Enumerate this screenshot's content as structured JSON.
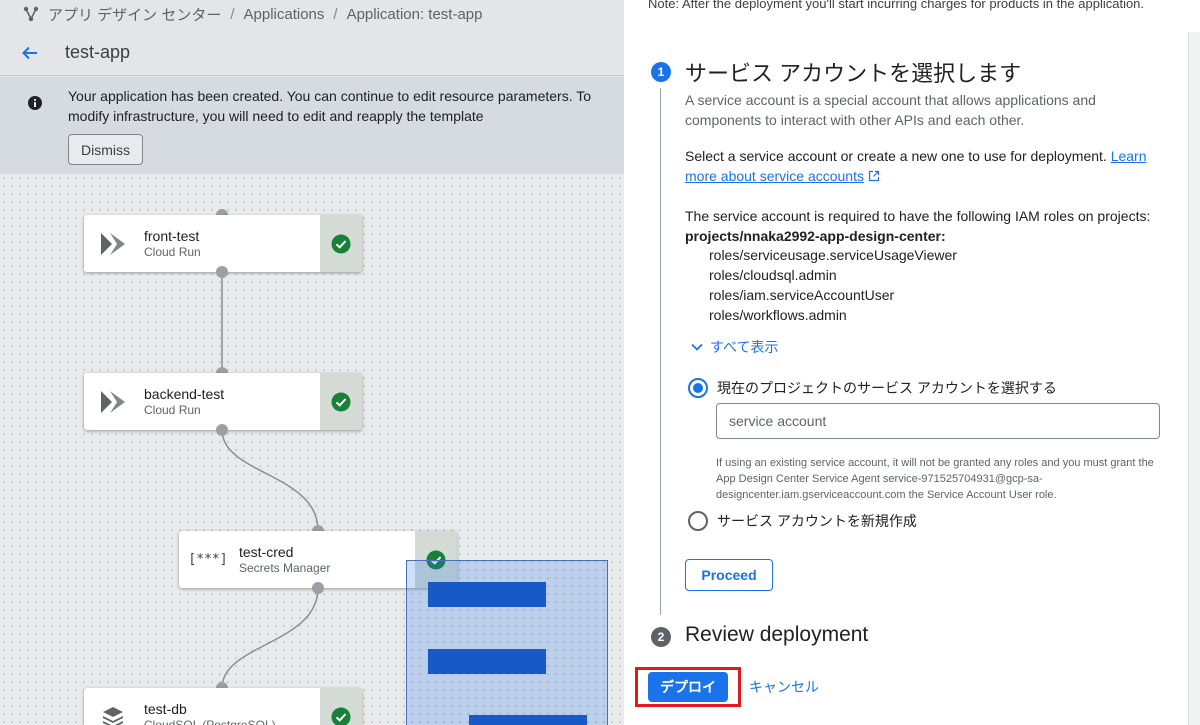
{
  "breadcrumb": {
    "items": [
      "アプリ デザイン センター",
      "Applications",
      "Application:  test-app"
    ],
    "separator": "/"
  },
  "header": {
    "title": "test-app"
  },
  "banner": {
    "message": "Your application has been created. You can continue to edit resource parameters. To modify infrastructure, you will need to edit and reapply the template",
    "dismiss_label": "Dismiss"
  },
  "nodes": [
    {
      "name": "front-test",
      "type": "Cloud Run",
      "icon": "cloud-run-icon",
      "status": "check-icon"
    },
    {
      "name": "backend-test",
      "type": "Cloud Run",
      "icon": "cloud-run-icon",
      "status": "check-icon"
    },
    {
      "name": "test-cred",
      "type": "Secrets Manager",
      "icon": "secret-manager-icon",
      "icon_glyph": "[***]",
      "status": "check-icon"
    },
    {
      "name": "test-db",
      "type": "CloudSQL (PostgreSQL)",
      "icon": "cloud-sql-icon",
      "status": "check-icon"
    }
  ],
  "panel": {
    "note": "Note: After the deployment you'll start incurring charges for products in the application.",
    "step1": {
      "number": "1",
      "title": "サービス アカウントを選択します",
      "description": "A service account is a special account that allows applications and components to interact with other APIs and each other.",
      "select_text": "Select a service account or create a new one to use for deployment.",
      "learn_link": "Learn more about service accounts",
      "required_text": "The service account is required to have the following IAM roles on projects:",
      "project": "projects/nnaka2992-app-design-center:",
      "roles": [
        "roles/serviceusage.serviceUsageViewer",
        "roles/cloudsql.admin",
        "roles/iam.serviceAccountUser",
        "roles/workflows.admin"
      ],
      "show_all_label": "すべて表示",
      "option_existing_label": "現在のプロジェクトのサービス アカウントを選択する",
      "service_account_placeholder": "service account",
      "hint": "If using an existing service account, it will not be granted any roles and you must grant the App Design Center Service Agent service-971525704931@gcp-sa-designcenter.iam.gserviceaccount.com the Service Account User role.",
      "option_new_label": "サービス アカウントを新規作成",
      "proceed_label": "Proceed"
    },
    "step2": {
      "number": "2",
      "title": "Review deployment"
    },
    "deploy_label": "デプロイ",
    "cancel_label": "キャンセル"
  },
  "colors": {
    "accent": "#1a73e8",
    "success": "#188038",
    "highlight_frame": "#e11b1b"
  }
}
